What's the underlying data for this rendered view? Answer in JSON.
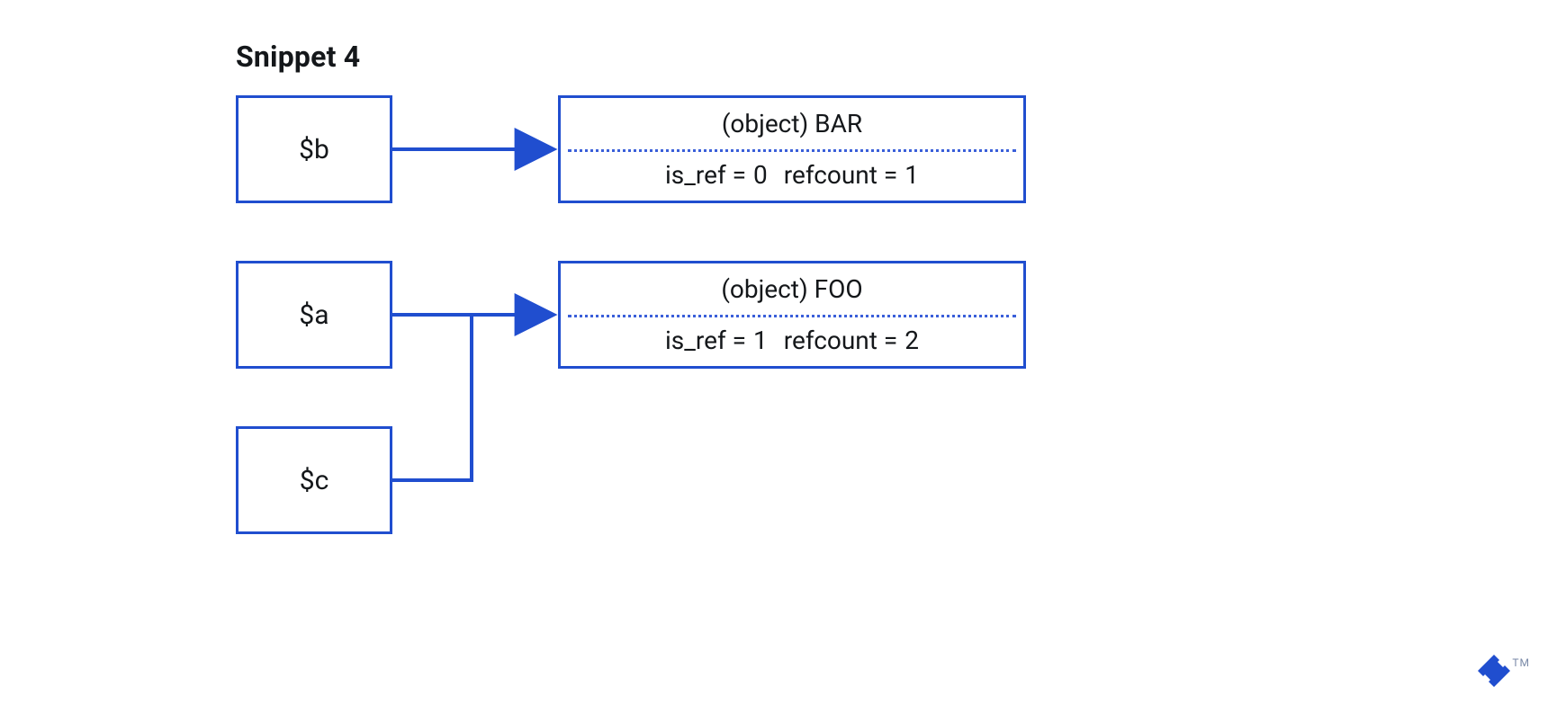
{
  "title": "Snippet 4",
  "vars": {
    "b": "$b",
    "a": "$a",
    "c": "$c"
  },
  "zvals": {
    "bar": {
      "header": "(object) BAR",
      "is_ref_label": "is_ref =",
      "is_ref_value": "0",
      "refcount_label": "refcount =",
      "refcount_value": "1"
    },
    "foo": {
      "header": "(object) FOO",
      "is_ref_label": "is_ref =",
      "is_ref_value": "1",
      "refcount_label": "refcount =",
      "refcount_value": "2"
    }
  },
  "trademark": "TM"
}
